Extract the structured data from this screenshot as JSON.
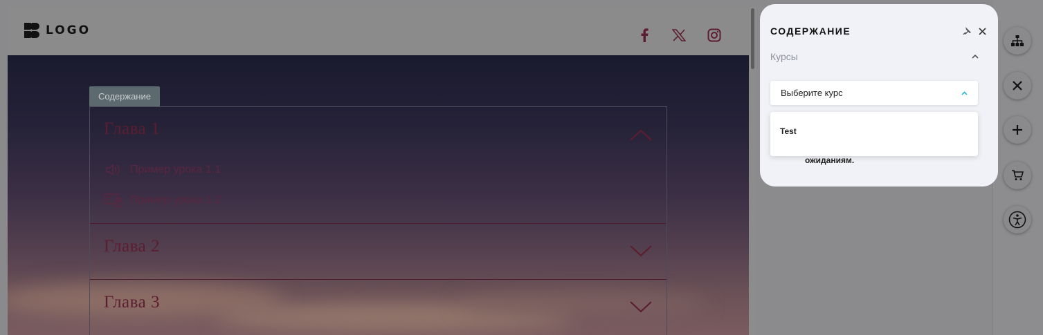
{
  "site": {
    "logo_text": "LOGO",
    "social": [
      "facebook-icon",
      "x-twitter-icon",
      "instagram-icon"
    ],
    "tab_label": "Содержание",
    "chapters": [
      {
        "title": "Глава 1",
        "expanded": true,
        "lessons": [
          {
            "title": "Пример урока 1.1",
            "icon": "audio-icon"
          },
          {
            "title": "Пример урока 1.2",
            "icon": "locked-lesson-icon"
          }
        ]
      },
      {
        "title": "Глава 2",
        "expanded": false
      },
      {
        "title": "Глава 3",
        "expanded": false
      }
    ],
    "colors": {
      "chapter_text": "#5d1d30",
      "overlay": "#8b8b8b"
    }
  },
  "panel": {
    "title": "СОДЕРЖАНИЕ",
    "courses_label": "Курсы",
    "select_placeholder": "Выберите курс",
    "options": [
      "Test"
    ],
    "partial_text": "ожиданиям.",
    "accent": "#29b6d8"
  },
  "toolbar": [
    "sitemap-icon",
    "close-icon",
    "plus-icon",
    "cart-icon",
    "accessibility-icon"
  ]
}
